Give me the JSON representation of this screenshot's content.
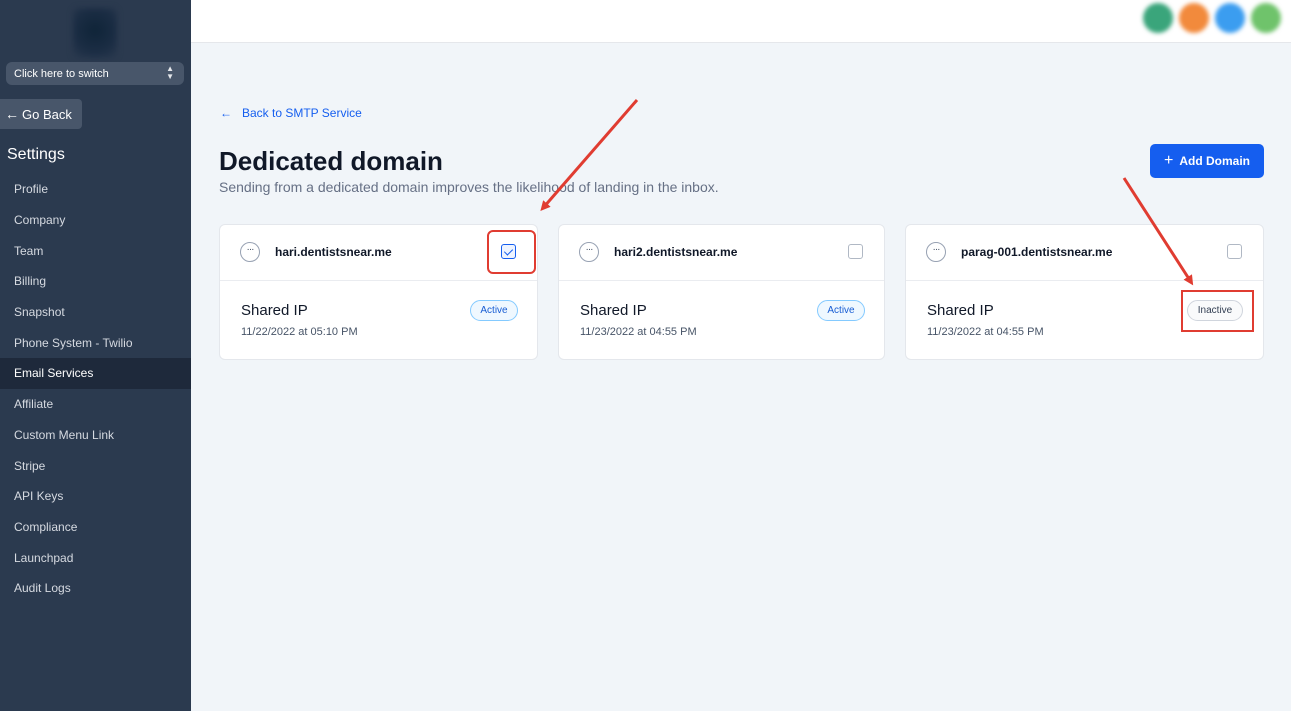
{
  "sidebar": {
    "switcher_label": "Click here to switch",
    "switcher_icon": "up-down-chevron-icon",
    "go_back_label": "Go Back",
    "settings_title": "Settings",
    "items": [
      {
        "label": "Profile"
      },
      {
        "label": "Company"
      },
      {
        "label": "Team"
      },
      {
        "label": "Billing"
      },
      {
        "label": "Snapshot"
      },
      {
        "label": "Phone System - Twilio"
      },
      {
        "label": "Email Services",
        "active": true
      },
      {
        "label": "Affiliate"
      },
      {
        "label": "Custom Menu Link"
      },
      {
        "label": "Stripe"
      },
      {
        "label": "API Keys"
      },
      {
        "label": "Compliance"
      },
      {
        "label": "Launchpad"
      },
      {
        "label": "Audit Logs"
      }
    ]
  },
  "topbar": {
    "avatar_colors": [
      "#3aa57b",
      "#f28a3c",
      "#3b9df0",
      "#6fc36b"
    ]
  },
  "main": {
    "back_link": "Back to SMTP Service",
    "title": "Dedicated domain",
    "subtitle": "Sending from a dedicated domain improves the likelihood of landing in the inbox.",
    "add_button": "Add Domain",
    "domains": [
      {
        "name": "hari.dentistsnear.me",
        "type": "Shared IP",
        "date": "11/22/2022 at 05:10 PM",
        "status": "Active",
        "checked": true
      },
      {
        "name": "hari2.dentistsnear.me",
        "type": "Shared IP",
        "date": "11/23/2022 at 04:55 PM",
        "status": "Active",
        "checked": false
      },
      {
        "name": "parag-001.dentistsnear.me",
        "type": "Shared IP",
        "date": "11/23/2022 at 04:55 PM",
        "status": "Inactive",
        "checked": false
      }
    ]
  },
  "colors": {
    "sidebar_bg": "#2b3a4f",
    "accent": "#155eef",
    "annotation": "#e03c31"
  }
}
